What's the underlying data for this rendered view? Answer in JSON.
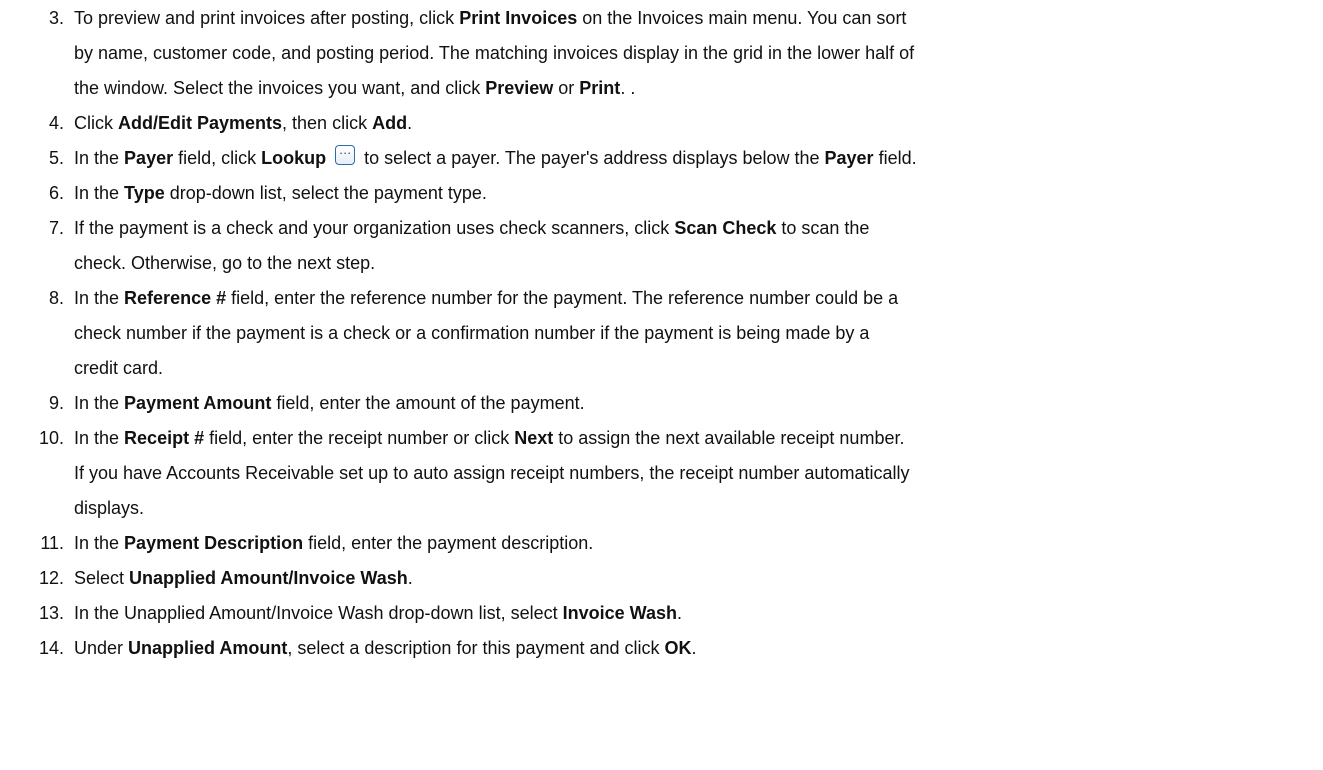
{
  "steps": [
    {
      "number": "3.",
      "lines": [
        [
          {
            "t": "To preview and print invoices after posting, click "
          },
          {
            "t": "Print Invoices",
            "b": true
          },
          {
            "t": " on the Invoices main menu. You can sort"
          }
        ],
        [
          {
            "t": "by name, customer code, and posting period. The matching invoices display in the grid in the lower half of"
          }
        ],
        [
          {
            "t": "the window. Select the invoices you want, and click "
          },
          {
            "t": "Preview",
            "b": true
          },
          {
            "t": " or "
          },
          {
            "t": "Print",
            "b": true
          },
          {
            "t": ". ."
          }
        ]
      ]
    },
    {
      "number": "4.",
      "lines": [
        [
          {
            "t": "Click "
          },
          {
            "t": "Add/Edit Payments",
            "b": true
          },
          {
            "t": ", then click "
          },
          {
            "t": "Add",
            "b": true
          },
          {
            "t": "."
          }
        ]
      ]
    },
    {
      "number": "5.",
      "lines": [
        [
          {
            "t": "In the "
          },
          {
            "t": "Payer",
            "b": true
          },
          {
            "t": " field, click "
          },
          {
            "t": "Lookup",
            "b": true
          },
          {
            "t": " "
          },
          {
            "icon": "lookup-ellipsis-icon"
          },
          {
            "t": " to select a payer. The payer's address displays below the "
          },
          {
            "t": "Payer",
            "b": true
          },
          {
            "t": " field."
          }
        ]
      ]
    },
    {
      "number": "6.",
      "lines": [
        [
          {
            "t": "In the "
          },
          {
            "t": "Type",
            "b": true
          },
          {
            "t": " drop-down list, select the payment type."
          }
        ]
      ]
    },
    {
      "number": "7.",
      "lines": [
        [
          {
            "t": "If the payment is a check and your organization uses check scanners, click "
          },
          {
            "t": "Scan Check",
            "b": true
          },
          {
            "t": " to scan the"
          }
        ],
        [
          {
            "t": "check. Otherwise, go to the next step."
          }
        ]
      ]
    },
    {
      "number": "8.",
      "lines": [
        [
          {
            "t": "In the "
          },
          {
            "t": "Reference #",
            "b": true
          },
          {
            "t": " field, enter the reference number for the payment. The reference number could be a"
          }
        ],
        [
          {
            "t": "check number if the payment is a check or a confirmation number if the payment is being made by a"
          }
        ],
        [
          {
            "t": "credit card."
          }
        ]
      ]
    },
    {
      "number": "9.",
      "lines": [
        [
          {
            "t": "In the "
          },
          {
            "t": "Payment Amount",
            "b": true
          },
          {
            "t": " field, enter the amount of the payment."
          }
        ]
      ]
    },
    {
      "number": "10.",
      "lines": [
        [
          {
            "t": "In the "
          },
          {
            "t": "Receipt #",
            "b": true
          },
          {
            "t": " field, enter the receipt number or click "
          },
          {
            "t": "Next",
            "b": true
          },
          {
            "t": " to assign the next available receipt number."
          }
        ],
        [
          {
            "t": "If you have Accounts Receivable set up to auto assign receipt numbers, the receipt number automatically"
          }
        ],
        [
          {
            "t": "displays."
          }
        ]
      ]
    },
    {
      "number": "11.",
      "lines": [
        [
          {
            "t": "In the "
          },
          {
            "t": "Payment Description",
            "b": true
          },
          {
            "t": " field, enter the payment description."
          }
        ]
      ]
    },
    {
      "number": "12.",
      "lines": [
        [
          {
            "t": "Select "
          },
          {
            "t": "Unapplied Amount/Invoice Wash",
            "b": true
          },
          {
            "t": "."
          }
        ]
      ]
    },
    {
      "number": "13.",
      "lines": [
        [
          {
            "t": "In the Unapplied Amount/Invoice Wash drop-down list, select "
          },
          {
            "t": "Invoice Wash",
            "b": true
          },
          {
            "t": "."
          }
        ]
      ]
    },
    {
      "number": "14.",
      "lines": [
        [
          {
            "t": "Under "
          },
          {
            "t": "Unapplied Amount",
            "b": true
          },
          {
            "t": ", select a description for this payment and click "
          },
          {
            "t": "OK",
            "b": true
          },
          {
            "t": "."
          }
        ]
      ]
    }
  ]
}
